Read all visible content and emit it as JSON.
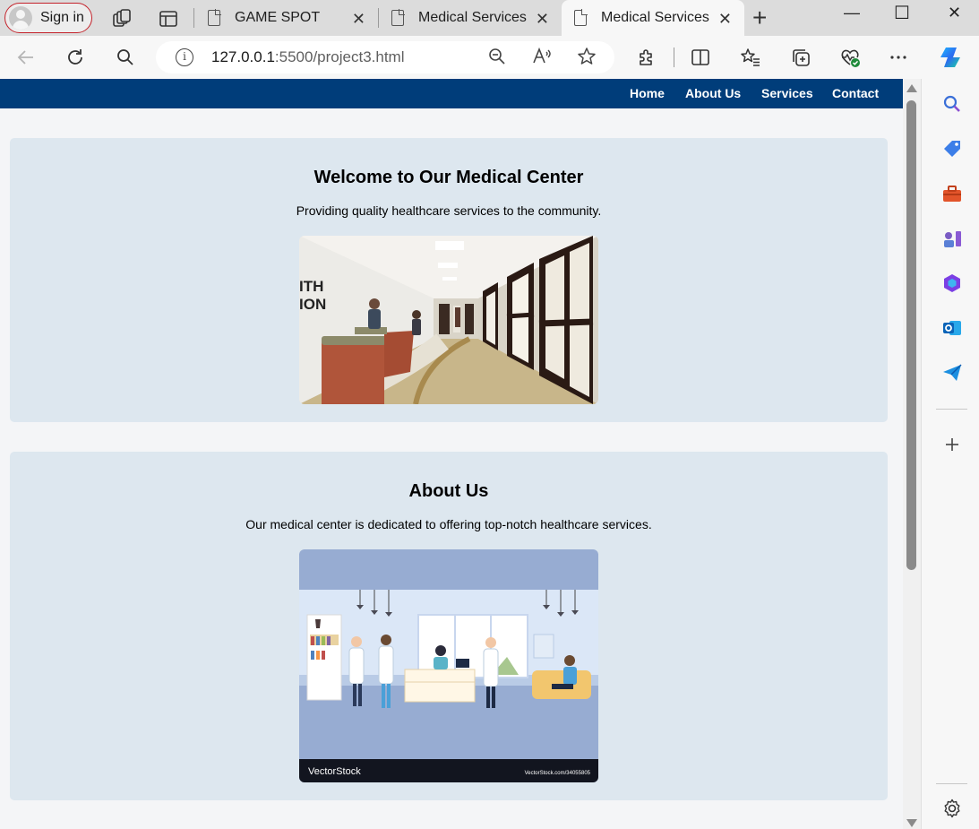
{
  "browser": {
    "sign_in_label": "Sign in",
    "tabs": [
      {
        "title": "GAME SPOT"
      },
      {
        "title": "Medical Services"
      },
      {
        "title": "Medical Services"
      }
    ],
    "close_glyph": "✕",
    "new_tab_glyph": "+",
    "address": {
      "host": "127.0.0.1",
      "path": ":5500/project3.html",
      "info_glyph": "i"
    },
    "window_controls": {
      "minimize": "—",
      "maximize": "☐",
      "close": "✕"
    },
    "toolbar_icons": [
      "back-arrow-icon",
      "refresh-icon",
      "search-icon",
      "zoom-out-icon",
      "read-aloud-icon",
      "favorite-star-icon",
      "extensions-icon",
      "split-screen-icon",
      "favorites-icon",
      "collections-icon",
      "browser-health-icon",
      "more-icon",
      "copilot-icon"
    ],
    "sidebar_icons": [
      "search-icon",
      "shopping-tag-icon",
      "toolbox-icon",
      "games-icon",
      "office-icon",
      "outlook-icon",
      "send-icon",
      "add-icon",
      "settings-gear-icon"
    ],
    "colors": {
      "signin_border": "#c4232b",
      "nav_bg": "#003d7a",
      "card_bg": "#dde7ef",
      "page_bg": "#f4f5f7"
    }
  },
  "site": {
    "nav": [
      "Home",
      "About Us",
      "Services",
      "Contact"
    ],
    "welcome": {
      "title": "Welcome to Our Medical Center",
      "subtitle": "Providing quality healthcare services to the community.",
      "image_sign": [
        "ITH",
        "ION"
      ]
    },
    "about": {
      "title": "About Us",
      "text": "Our medical center is dedicated to offering top-notch healthcare services.",
      "watermark_brand": "VectorStock",
      "watermark_url": "VectorStock.com/34055805"
    }
  }
}
